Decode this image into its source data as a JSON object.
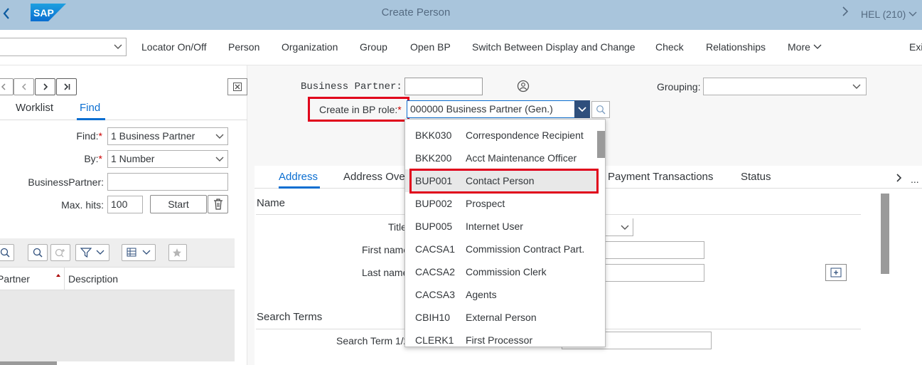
{
  "shell": {
    "title": "Create Person",
    "system": "HEL (210)",
    "logo_text": "SAP"
  },
  "toolbar": {
    "items": [
      "Locator On/Off",
      "Person",
      "Organization",
      "Group",
      "Open BP",
      "Switch Between Display and Change",
      "Check",
      "Relationships",
      "More",
      "Exi"
    ]
  },
  "left": {
    "tabs": [
      "Worklist",
      "Find"
    ],
    "find_label": "Find:",
    "find_value": "1 Business Partner",
    "by_label": "By:",
    "by_value": "1 Number",
    "bp_label": "BusinessPartner:",
    "maxhits_label": "Max. hits:",
    "maxhits_value": "100",
    "start_label": "Start",
    "columns": [
      "Partner",
      "Description"
    ]
  },
  "header": {
    "bp_label": "Business Partner:",
    "grouping_label": "Grouping:",
    "role_label": "Create in BP role:",
    "role_value": "000000 Business Partner (Gen.)"
  },
  "content": {
    "tabs": [
      "Address",
      "Address Ove",
      "Payment Transactions",
      "Status"
    ],
    "more_dots": "...",
    "name_section": "Name",
    "title_label": "Title",
    "first_label": "First name",
    "last_label": "Last name",
    "search_section": "Search Terms",
    "search_label": "Search Term 1/2"
  },
  "dropdown": {
    "items": [
      {
        "code": "BKK030",
        "desc": "Correspondence Recipient"
      },
      {
        "code": "BKK200",
        "desc": "Acct Maintenance Officer"
      },
      {
        "code": "BUP001",
        "desc": "Contact Person"
      },
      {
        "code": "BUP002",
        "desc": "Prospect"
      },
      {
        "code": "BUP005",
        "desc": "Internet User"
      },
      {
        "code": "CACSA1",
        "desc": "Commission Contract Part."
      },
      {
        "code": "CACSA2",
        "desc": "Commission Clerk"
      },
      {
        "code": "CACSA3",
        "desc": "Agents"
      },
      {
        "code": "CBIH10",
        "desc": "External Person"
      },
      {
        "code": "CLERK1",
        "desc": "First Processor"
      }
    ],
    "selected_index": 2
  },
  "colors": {
    "shell": "#a9c5dc",
    "accent": "#0a6ed1",
    "highlight": "#e0001b"
  }
}
